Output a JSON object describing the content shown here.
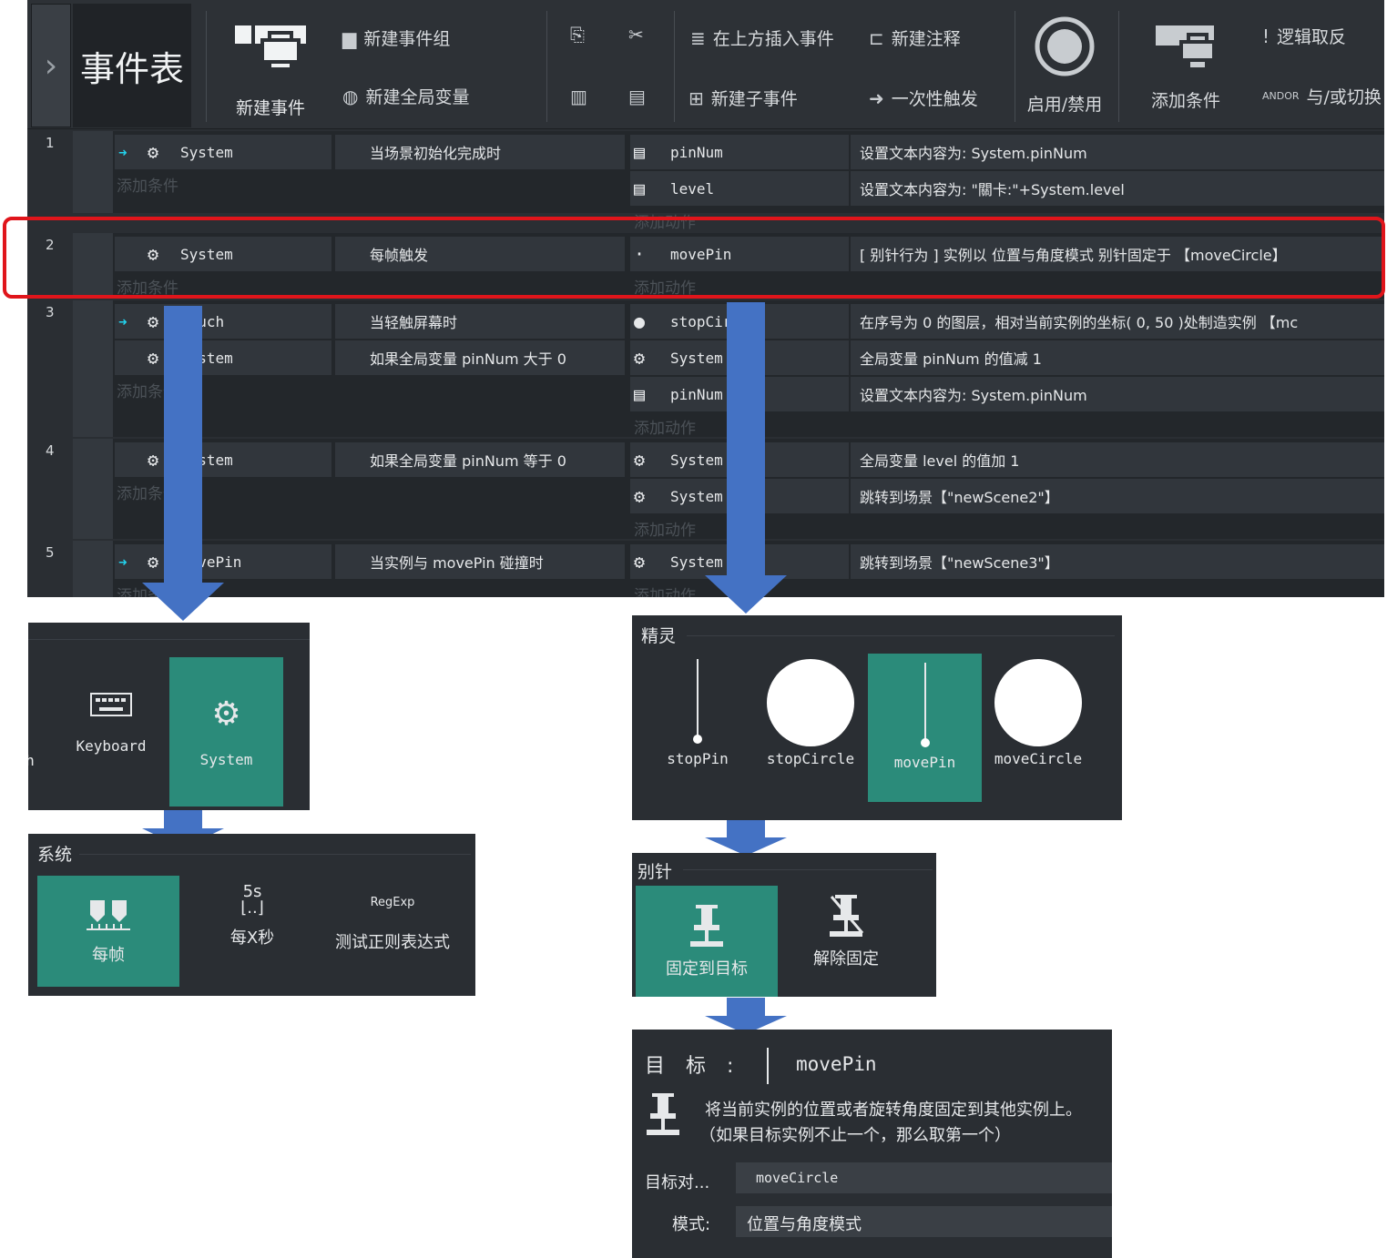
{
  "toolbar": {
    "title": "事件表",
    "new_event": "新建事件",
    "new_group": "新建事件组",
    "new_global": "新建全局变量",
    "insert_above": "在上方插入事件",
    "new_comment": "新建注释",
    "new_sub": "新建子事件",
    "once": "一次性触发",
    "toggle": "启用/禁用",
    "add_cond": "添加条件",
    "negate": "逻辑取反",
    "andor": "与/或切换"
  },
  "hints": {
    "add_cond": "添加条件",
    "add_action": "添加动作"
  },
  "events": [
    {
      "num": "1",
      "conds": [
        {
          "obj": "System",
          "desc": "当场景初始化完成时",
          "trigger": true
        }
      ],
      "actions": [
        {
          "obj": "pinNum",
          "desc": "设置文本内容为: System.pinNum"
        },
        {
          "obj": "level",
          "desc": "设置文本内容为: \"關卡:\"+System.level"
        }
      ]
    },
    {
      "num": "2",
      "conds": [
        {
          "obj": "System",
          "desc": "每帧触发"
        }
      ],
      "actions": [
        {
          "obj": "movePin",
          "desc": "[ 别针行为 ] 实例以 位置与角度模式 别针固定于 【moveCircle】"
        }
      ]
    },
    {
      "num": "3",
      "conds": [
        {
          "obj": "Touch",
          "desc": "当轻触屏幕时",
          "trigger": true
        },
        {
          "obj": "System",
          "desc": "如果全局变量 pinNum 大于 0"
        }
      ],
      "actions": [
        {
          "obj": "stopCircle",
          "desc": "在序号为 0 的图层，相对当前实例的坐标( 0, 50 )处制造实例 【mc"
        },
        {
          "obj": "System",
          "desc": "全局变量 pinNum 的值减 1"
        },
        {
          "obj": "pinNum",
          "desc": "设置文本内容为: System.pinNum"
        }
      ]
    },
    {
      "num": "4",
      "conds": [
        {
          "obj": "System",
          "desc": "如果全局变量 pinNum 等于 0"
        }
      ],
      "actions": [
        {
          "obj": "System",
          "desc": "全局变量 level 的值加 1"
        },
        {
          "obj": "System",
          "desc": "跳转到场景【\"newScene2\"】"
        }
      ]
    },
    {
      "num": "5",
      "conds": [
        {
          "obj": "movePin",
          "desc": "当实例与 movePin 碰撞时",
          "trigger": true
        }
      ],
      "actions": [
        {
          "obj": "System",
          "desc": "跳转到场景【\"newScene3\"】"
        }
      ]
    }
  ],
  "objpicker": {
    "partial": "h",
    "keyboard": "Keyboard",
    "system": "System"
  },
  "syspanel": {
    "title": "系统",
    "items": [
      "每帧",
      "每X秒",
      "测试正则表达式"
    ],
    "sec_label": "5s",
    "regexp_label": "RegExp"
  },
  "sprites": {
    "title": "精灵",
    "items": [
      "stopPin",
      "stopCircle",
      "movePin",
      "moveCircle"
    ]
  },
  "pin": {
    "title": "别针",
    "items": [
      "固定到目标",
      "解除固定"
    ]
  },
  "params": {
    "target_label": "目 标 :",
    "target_obj": "movePin",
    "desc1": "将当前实例的位置或者旋转角度固定到其他实例上。",
    "desc2": "（如果目标实例不止一个，那么取第一个）",
    "obj_label": "目标对...",
    "obj_value": "moveCircle",
    "mode_label": "模式:",
    "mode_value": "位置与角度模式"
  },
  "colors": {
    "highlight": "#2b8b7a",
    "arrow": "#4472c4",
    "frame": "#e0151b"
  }
}
